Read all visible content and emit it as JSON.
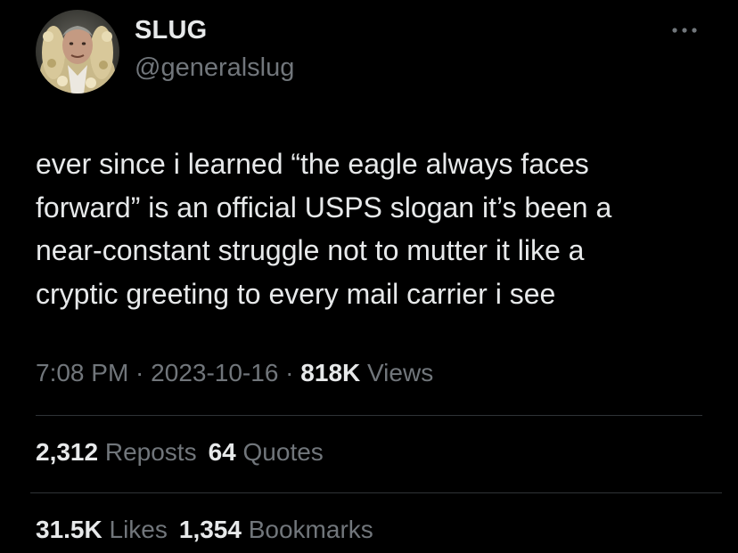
{
  "author": {
    "display_name": "SLUG",
    "handle": "@generalslug"
  },
  "tweet": {
    "text": "ever since i learned “the eagle always faces\nforward” is an official USPS slogan it’s been a\nnear-constant struggle not to mutter it like a\ncryptic greeting to every mail carrier i see"
  },
  "meta": {
    "time": "7:08 PM",
    "separator": " · ",
    "date": "2023-10-16",
    "views_count": "818K",
    "views_label": "Views"
  },
  "stats": {
    "reposts_count": "2,312",
    "reposts_label": "Reposts",
    "quotes_count": "64",
    "quotes_label": "Quotes",
    "likes_count": "31.5K",
    "likes_label": "Likes",
    "bookmarks_count": "1,354",
    "bookmarks_label": "Bookmarks"
  },
  "icons": {
    "more": "more-horizontal-icon"
  },
  "colors": {
    "background": "#000000",
    "primary_text": "#e7e9ea",
    "secondary_text": "#71767b",
    "divider": "#2f3336"
  }
}
